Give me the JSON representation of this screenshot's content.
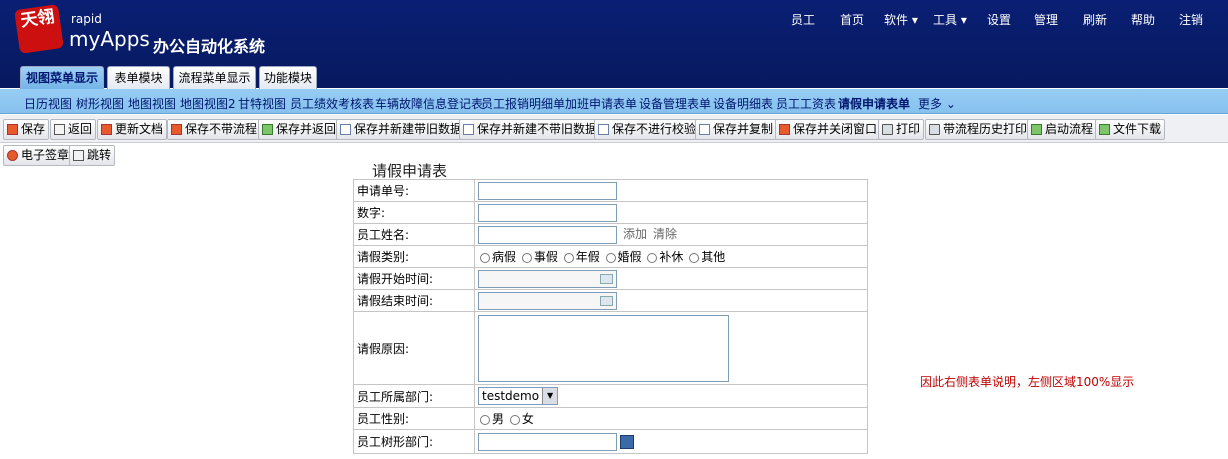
{
  "header": {
    "logo_text": "天翎",
    "brand_small": "rapid",
    "brand_big": "myApps",
    "brand_cn": "办公自动化系统",
    "topnav": [
      "员工",
      "首页",
      "软件 ▾",
      "工具 ▾",
      "设置",
      "管理",
      "刷新",
      "帮助",
      "注销"
    ]
  },
  "module_tabs": [
    "视图菜单显示",
    "表单模块",
    "流程菜单显示",
    "功能模块"
  ],
  "submenu": [
    "日历视图",
    "树形视图",
    "地图视图",
    "地图视图2",
    "甘特视图",
    "员工绩效考核表",
    "车辆故障信息登记表",
    "员工报销明细单",
    "加班申请表单",
    "设备管理表单",
    "设备明细表",
    "员工工资表",
    "请假申请表单",
    "更多 ⌄"
  ],
  "toolbar": [
    "保存",
    "返回",
    "更新文档",
    "保存不带流程",
    "保存并返回",
    "保存并新建带旧数据",
    "保存并新建不带旧数据",
    "保存不进行校验",
    "保存并复制",
    "保存并关闭窗口",
    "打印",
    "带流程历史打印",
    "启动流程",
    "文件下载"
  ],
  "toolbar2": [
    "电子签章",
    "跳转"
  ],
  "form": {
    "title": "请假申请表",
    "fields": {
      "apply_no": "申请单号:",
      "number": "数字:",
      "name": "员工姓名:",
      "add": "添加",
      "clear": "清除",
      "leave_type": "请假类别:",
      "types": [
        "病假",
        "事假",
        "年假",
        "婚假",
        "补休",
        "其他"
      ],
      "start": "请假开始时间:",
      "end": "请假结束时间:",
      "reason": "请假原因:",
      "dept": "员工所属部门:",
      "dept_value": "testdemo",
      "gender": "员工性别:",
      "genders": [
        "男",
        "女"
      ],
      "tree_dept": "员工树形部门:"
    }
  },
  "note": "因此右侧表单说明，左侧区域100%显示"
}
